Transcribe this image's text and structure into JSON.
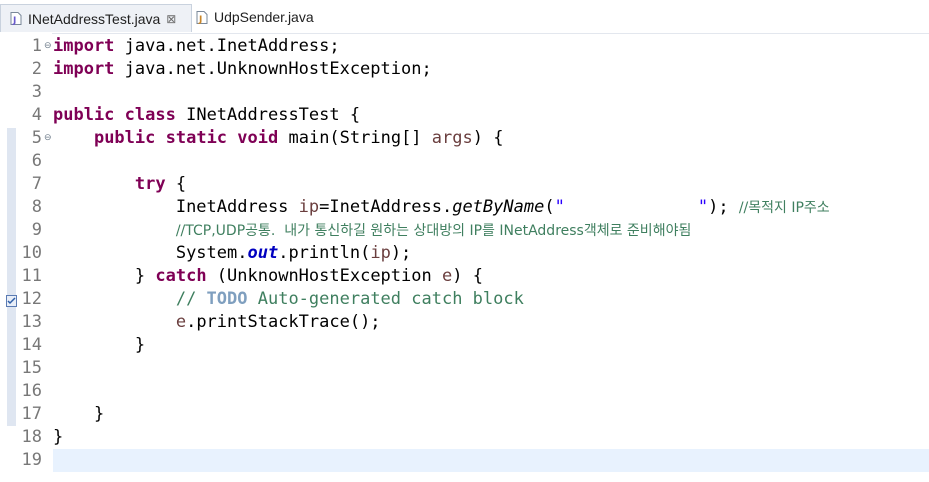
{
  "tabs": [
    {
      "label": "INetAddressTest.java",
      "close": "⊠",
      "active": true
    },
    {
      "label": "UdpSender.java",
      "active": false
    }
  ],
  "line_numbers": [
    "1",
    "2",
    "3",
    "4",
    "5",
    "6",
    "7",
    "8",
    "9",
    "10",
    "11",
    "12",
    "13",
    "14",
    "15",
    "16",
    "17",
    "18",
    "19"
  ],
  "fold_markers": {
    "1": "⊖",
    "5": "⊖"
  },
  "code": {
    "l1": {
      "kw": "import",
      "rest": " java.net.InetAddress;"
    },
    "l2": {
      "kw": "import",
      "rest": " java.net.UnknownHostException;"
    },
    "l4": {
      "kw1": "public",
      "kw2": "class",
      "rest": " INetAddressTest {"
    },
    "l5": {
      "indent": "    ",
      "kw1": "public",
      "kw2": "static",
      "kw3": "void",
      "rest1": " main(String[] ",
      "arg": "args",
      "rest2": ") {"
    },
    "l7": {
      "indent": "        ",
      "kw": "try",
      "rest": " {"
    },
    "l8": {
      "indent": "            ",
      "a": "InetAddress ",
      "ip": "ip",
      "b": "=InetAddress.",
      "m": "getByName",
      "c": "(",
      "str": "\"             \"",
      "d": "); ",
      "cm": "//목적지 IP주소"
    },
    "l9": {
      "indent": "            ",
      "cm": "//TCP,UDP공통.  내가 통신하길 원하는 상대방의 IP를 INetAddress객체로 준비해야됨"
    },
    "l10": {
      "indent": "            ",
      "a": "System.",
      "out": "out",
      "b": ".println(",
      "ip": "ip",
      "c": ");"
    },
    "l11": {
      "indent": "        ",
      "a": "} ",
      "kw": "catch",
      "b": " (UnknownHostException ",
      "e": "e",
      "c": ") {"
    },
    "l12": {
      "indent": "            ",
      "cm1": "// ",
      "todo": "TODO",
      "cm2": " Auto-generated catch block"
    },
    "l13": {
      "indent": "            ",
      "e": "e",
      "rest": ".printStackTrace();"
    },
    "l14": {
      "indent": "        ",
      "rest": "}"
    },
    "l17": {
      "indent": "    ",
      "rest": "}"
    },
    "l18": {
      "rest": "}"
    }
  }
}
